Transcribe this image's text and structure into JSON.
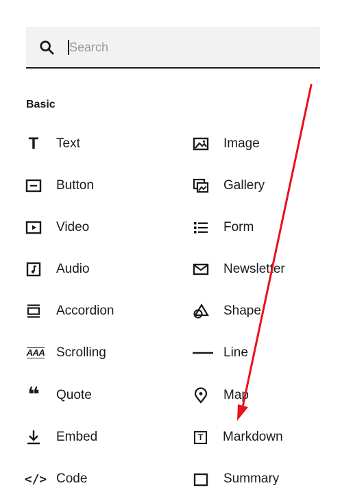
{
  "search": {
    "placeholder": "Search"
  },
  "section": {
    "title": "Basic"
  },
  "blocks": {
    "text": "Text",
    "image": "Image",
    "button": "Button",
    "gallery": "Gallery",
    "video": "Video",
    "form": "Form",
    "audio": "Audio",
    "newsletter": "Newsletter",
    "accordion": "Accordion",
    "shape": "Shape",
    "scrolling": "Scrolling",
    "line": "Line",
    "quote": "Quote",
    "map": "Map",
    "embed": "Embed",
    "markdown": "Markdown",
    "code": "Code",
    "summary": "Summary"
  },
  "icons": {
    "scrolling_glyph": "AAA",
    "quote_glyph": "❝",
    "code_glyph": "</>",
    "text_glyph": "T",
    "markdown_glyph": "T"
  },
  "colors": {
    "annotation_arrow": "#e8121a",
    "search_bg": "#f2f2f2"
  }
}
